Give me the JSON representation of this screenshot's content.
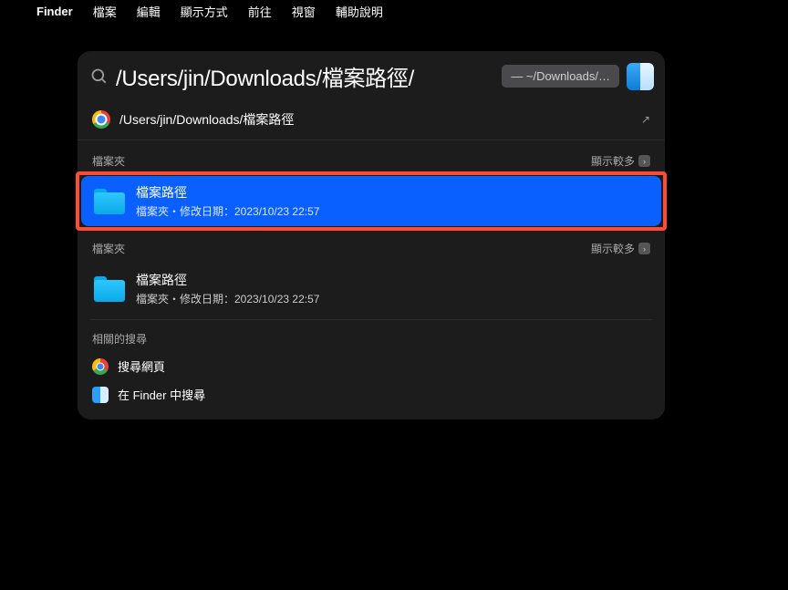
{
  "menubar": {
    "app_name": "Finder",
    "items": [
      "檔案",
      "編輯",
      "顯示方式",
      "前往",
      "視窗",
      "輔助說明"
    ]
  },
  "search": {
    "query": "/Users/jin/Downloads/檔案路徑/",
    "path_chip": "— ~/Downloads/…"
  },
  "top_hit": {
    "text": "/Users/jin/Downloads/檔案路徑"
  },
  "sections": [
    {
      "label": "檔案夾",
      "show_more": "顯示較多",
      "items": [
        {
          "title": "檔案路徑",
          "subtitle": "檔案夾・修改日期：2023/10/23 22:57",
          "selected": true,
          "highlighted": true
        }
      ]
    },
    {
      "label": "檔案夾",
      "show_more": "顯示較多",
      "items": [
        {
          "title": "檔案路徑",
          "subtitle": "檔案夾・修改日期：2023/10/23 22:57",
          "selected": false,
          "highlighted": false
        }
      ]
    }
  ],
  "related": {
    "label": "相關的搜尋",
    "items": [
      {
        "icon": "chrome",
        "text": "搜尋網頁"
      },
      {
        "icon": "finder",
        "text": "在 Finder 中搜尋"
      }
    ]
  }
}
